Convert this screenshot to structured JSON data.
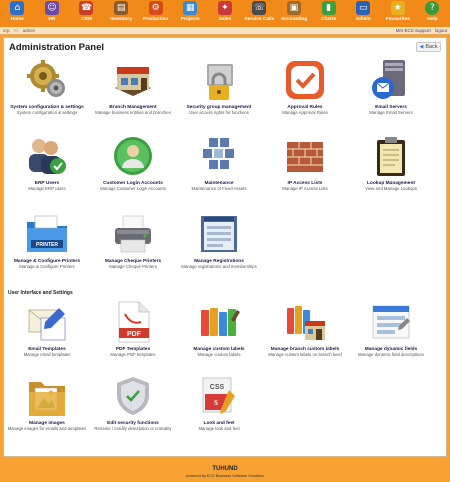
{
  "nav": [
    {
      "label": "Home",
      "icon": "home-icon",
      "color": "#2e6fc9",
      "glyph": "⌂"
    },
    {
      "label": "HR",
      "icon": "people-icon",
      "color": "#6b4aa8",
      "glyph": "☺"
    },
    {
      "label": "CRM",
      "icon": "crm-icon",
      "color": "#c8402a",
      "glyph": "☎"
    },
    {
      "label": "Inventory",
      "icon": "inventory-icon",
      "color": "#8a5a2a",
      "glyph": "▤"
    },
    {
      "label": "Production",
      "icon": "production-icon",
      "color": "#d84a1a",
      "glyph": "⚙"
    },
    {
      "label": "Projects",
      "icon": "projects-icon",
      "color": "#3a8ad0",
      "glyph": "▦"
    },
    {
      "label": "Sales",
      "icon": "sales-icon",
      "color": "#c93a3a",
      "glyph": "✦"
    },
    {
      "label": "Service Calls",
      "icon": "service-calls-icon",
      "color": "#4a4a4a",
      "glyph": "☏"
    },
    {
      "label": "Accounting",
      "icon": "accounting-icon",
      "color": "#a06a2a",
      "glyph": "▣"
    },
    {
      "label": "Charts",
      "icon": "charts-icon",
      "color": "#3aa040",
      "glyph": "▮"
    },
    {
      "label": "Admin",
      "icon": "admin-icon",
      "color": "#2a62b8",
      "glyph": "▭"
    },
    {
      "label": "Favourites",
      "icon": "favourites-icon",
      "color": "#e8b020",
      "glyph": "★"
    },
    {
      "label": "Help",
      "icon": "help-icon",
      "color": "#3a9a3a",
      "glyph": "?"
    }
  ],
  "breadcrumb": {
    "home": "erp",
    "sep": ">>",
    "current": "admin",
    "user": "Mrs ECS Support",
    "logout": "logout"
  },
  "panel": {
    "title": "Administration Panel",
    "back_label": "Back"
  },
  "section": {
    "ui_settings": "User Interface and Settings"
  },
  "tiles": [
    {
      "title": "System configuration & settings",
      "sub": "System configuration & settings"
    },
    {
      "title": "Branch Management",
      "sub": "Manage business entities and branches"
    },
    {
      "title": "Security group management",
      "sub": "User access rights for functions"
    },
    {
      "title": "Approval Rules",
      "sub": "Manage Approval Rules"
    },
    {
      "title": "Email Servers",
      "sub": "Manage Email Servers"
    },
    {
      "title": "ERP Users",
      "sub": "Manage ERP users"
    },
    {
      "title": "Customer Login Accounts",
      "sub": "Manage Customer Login Accounts"
    },
    {
      "title": "Maintenance",
      "sub": "Maintenance of Fixed Assets"
    },
    {
      "title": "IP Access Lists",
      "sub": "Manage IP Access Lists"
    },
    {
      "title": "Lookup Management",
      "sub": "View and Manage Lookups"
    },
    {
      "title": "Manage & Configure Printers",
      "sub": "Manage & Configure Printers"
    },
    {
      "title": "Manage Cheque Printers",
      "sub": "Manage Cheque Printers"
    },
    {
      "title": "Manage Registrations",
      "sub": "Manage registrations and memberships"
    },
    {
      "title": "Email Templates",
      "sub": "Manage email templates"
    },
    {
      "title": "PDF Templates",
      "sub": "Manage PDF templates"
    },
    {
      "title": "Manage custom labels",
      "sub": "Manage custom labels"
    },
    {
      "title": "Manage branch custom labels",
      "sub": "Manage custom labels on branch level"
    },
    {
      "title": "Manage dynamic fields",
      "sub": "Manage dynamic field descriptions"
    },
    {
      "title": "Manage images",
      "sub": "Manage images for emails and templates"
    },
    {
      "title": "Edit security functions",
      "sub": "Rename / modify description or criticality"
    },
    {
      "title": "Look and feel",
      "sub": "Manage look and feel"
    }
  ],
  "icon_labels": {
    "printer": "PRINTER",
    "pdf": "PDF",
    "css": "CSS"
  },
  "footer": {
    "brand": "TUHUND",
    "powered": "powered by ECS Business Software Solutions"
  }
}
